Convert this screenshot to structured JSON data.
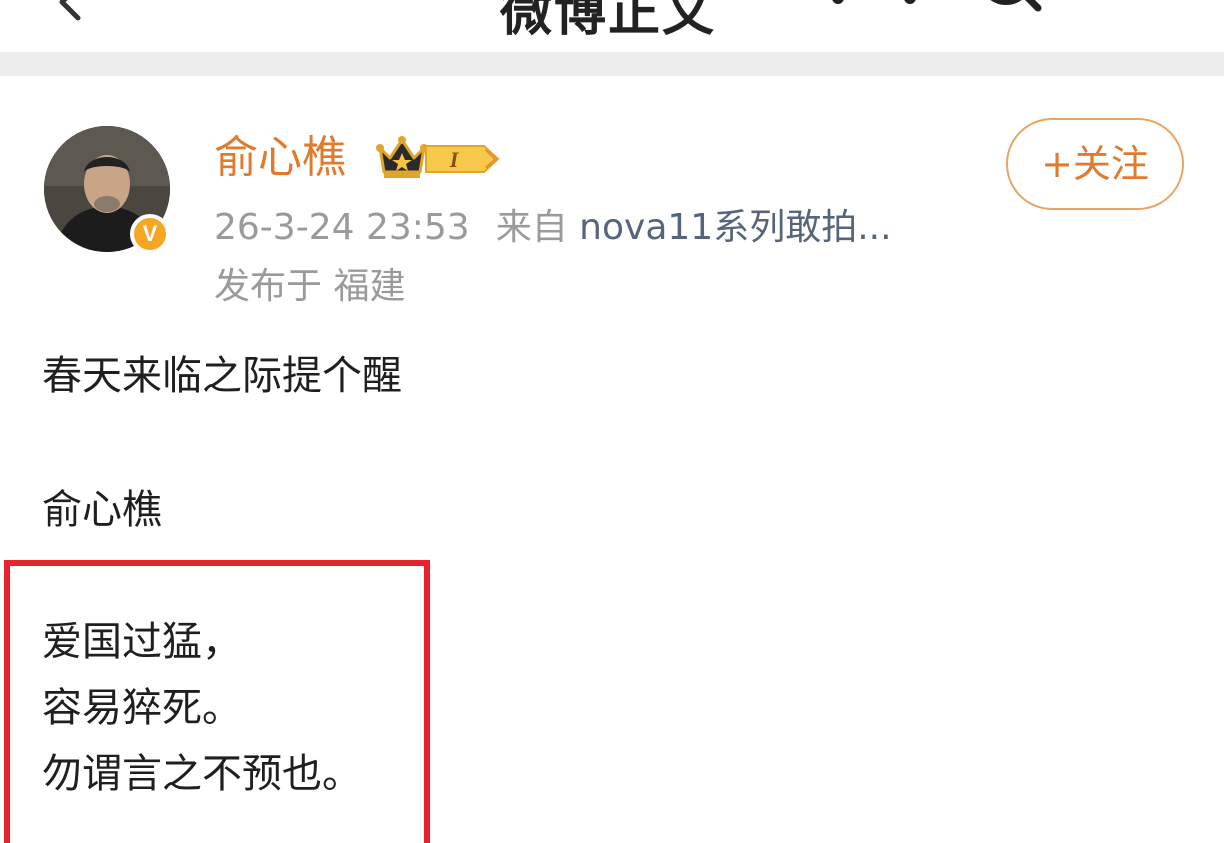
{
  "header": {
    "title": "微博正文",
    "back_icon": "chevron-left-icon",
    "signal_icon": "audio-signal-icon",
    "search_icon": "search-icon"
  },
  "post": {
    "author": {
      "name": "俞心樵",
      "verified_badge": "V",
      "verified_color": "#f5a623",
      "crown_icon": "crown-icon",
      "level_badge_text": "I"
    },
    "follow_button": "+关注",
    "timestamp": "26-3-24 23:53",
    "source_prefix": "来自",
    "source_name": "nova11系列敢拍...",
    "location": "发布于 福建",
    "lines": [
      "春天来临之际提个醒",
      "俞心樵",
      "爱国过猛，",
      "容易猝死。",
      "勿谓言之不预也。"
    ],
    "highlight_color": "#e8232f"
  },
  "colors": {
    "username": "#e07a2e",
    "meta": "#9a9a9a",
    "source_link": "#56657a",
    "divider": "#ededed"
  }
}
